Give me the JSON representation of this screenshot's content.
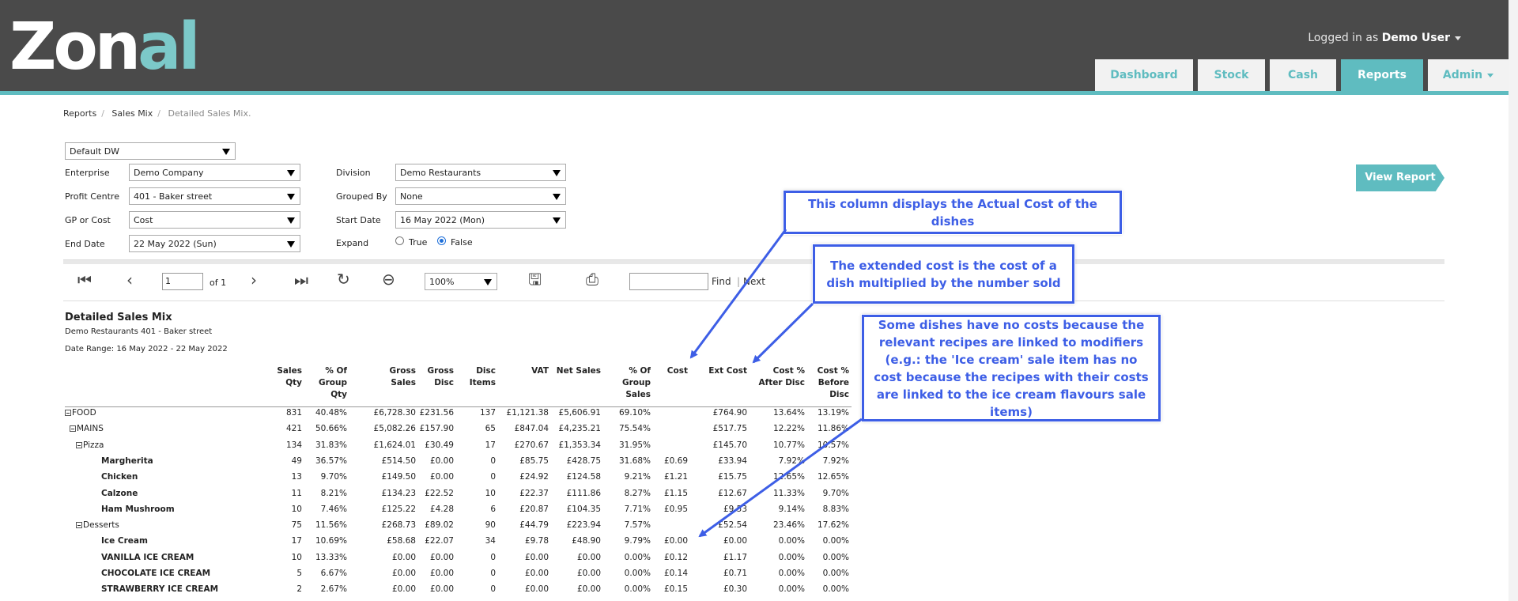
{
  "header": {
    "logo": {
      "part1": "Zon",
      "part2": "al"
    },
    "logged_in_prefix": "Logged in as",
    "user": "Demo User",
    "nav": [
      {
        "label": "Dashboard",
        "active": false
      },
      {
        "label": "Stock",
        "active": false
      },
      {
        "label": "Cash",
        "active": false
      },
      {
        "label": "Reports",
        "active": true
      },
      {
        "label": "Admin",
        "active": false
      }
    ],
    "colors": {
      "bar": "#4a4a4a",
      "accent": "#5fbcc0"
    }
  },
  "breadcrumb": [
    "Reports",
    "Sales Mix",
    "Detailed Sales Mix."
  ],
  "params": {
    "datasource": "Default DW",
    "enterprise_label": "Enterprise",
    "enterprise": "Demo Company",
    "profit_centre_label": "Profit Centre",
    "profit_centre": "401 - Baker street",
    "gp_label": "GP or Cost",
    "gp": "Cost",
    "end_date_label": "End Date",
    "end_date": "22 May 2022 (Sun)",
    "division_label": "Division",
    "division": "Demo Restaurants",
    "grouped_by_label": "Grouped By",
    "grouped_by": "None",
    "start_date_label": "Start Date",
    "start_date": "16 May 2022 (Mon)",
    "expand_label": "Expand",
    "expand_true": "True",
    "expand_false": "False",
    "view_report": "View Report"
  },
  "toolbar": {
    "page": "1",
    "of": "of 1",
    "zoom": "100%",
    "find": "Find",
    "sep": "|",
    "next": "Next",
    "icons": [
      "first-page-icon",
      "previous-page-icon",
      "next-page-icon",
      "last-page-icon",
      "refresh-icon",
      "back-icon",
      "save-icon",
      "print-icon"
    ]
  },
  "report": {
    "title": "Detailed Sales Mix",
    "subtitle": "Demo Restaurants 401 - Baker street",
    "date_range": "Date Range: 16 May 2022 - 22 May 2022",
    "columns": [
      "Sales\nQty",
      "% Of\nGroup\nQty",
      "Gross\nSales",
      "Gross\nDisc",
      "Disc\nItems",
      "VAT",
      "Net Sales",
      "% Of\nGroup\nSales",
      "Cost",
      "Ext Cost",
      "Cost %\nAfter Disc",
      "Cost %\nBefore\nDisc"
    ],
    "rows": [
      {
        "name": "FOOD",
        "level": 0,
        "tree": true,
        "bold": false,
        "vals": [
          "831",
          "40.48%",
          "£6,728.30",
          "£231.56",
          "137",
          "£1,121.38",
          "£5,606.91",
          "69.10%",
          "",
          "£764.90",
          "13.64%",
          "13.19%"
        ]
      },
      {
        "name": "MAINS",
        "level": 1,
        "tree": true,
        "bold": false,
        "vals": [
          "421",
          "50.66%",
          "£5,082.26",
          "£157.90",
          "65",
          "£847.04",
          "£4,235.21",
          "75.54%",
          "",
          "£517.75",
          "12.22%",
          "11.86%"
        ]
      },
      {
        "name": "Pizza",
        "level": 2,
        "tree": true,
        "bold": false,
        "vals": [
          "134",
          "31.83%",
          "£1,624.01",
          "£30.49",
          "17",
          "£270.67",
          "£1,353.34",
          "31.95%",
          "",
          "£145.70",
          "10.77%",
          "10.57%"
        ]
      },
      {
        "name": "Margherita",
        "level": 3,
        "tree": false,
        "bold": true,
        "vals": [
          "49",
          "36.57%",
          "£514.50",
          "£0.00",
          "0",
          "£85.75",
          "£428.75",
          "31.68%",
          "£0.69",
          "£33.94",
          "7.92%",
          "7.92%"
        ]
      },
      {
        "name": "Chicken",
        "level": 3,
        "tree": false,
        "bold": true,
        "vals": [
          "13",
          "9.70%",
          "£149.50",
          "£0.00",
          "0",
          "£24.92",
          "£124.58",
          "9.21%",
          "£1.21",
          "£15.75",
          "12.65%",
          "12.65%"
        ]
      },
      {
        "name": "Calzone",
        "level": 3,
        "tree": false,
        "bold": true,
        "vals": [
          "11",
          "8.21%",
          "£134.23",
          "£22.52",
          "10",
          "£22.37",
          "£111.86",
          "8.27%",
          "£1.15",
          "£12.67",
          "11.33%",
          "9.70%"
        ]
      },
      {
        "name": "Ham Mushroom",
        "level": 3,
        "tree": false,
        "bold": true,
        "vals": [
          "10",
          "7.46%",
          "£125.22",
          "£4.28",
          "6",
          "£20.87",
          "£104.35",
          "7.71%",
          "£0.95",
          "£9.53",
          "9.14%",
          "8.83%"
        ]
      },
      {
        "name": "Desserts",
        "level": 2,
        "tree": true,
        "bold": false,
        "vals": [
          "75",
          "11.56%",
          "£268.73",
          "£89.02",
          "90",
          "£44.79",
          "£223.94",
          "7.57%",
          "",
          "£52.54",
          "23.46%",
          "17.62%"
        ]
      },
      {
        "name": "Ice Cream",
        "level": 3,
        "tree": false,
        "bold": true,
        "vals": [
          "17",
          "10.69%",
          "£58.68",
          "£22.07",
          "34",
          "£9.78",
          "£48.90",
          "9.79%",
          "£0.00",
          "£0.00",
          "0.00%",
          "0.00%"
        ]
      },
      {
        "name": "VANILLA ICE CREAM",
        "level": 3,
        "tree": false,
        "bold": true,
        "vals": [
          "10",
          "13.33%",
          "£0.00",
          "£0.00",
          "0",
          "£0.00",
          "£0.00",
          "0.00%",
          "£0.12",
          "£1.17",
          "0.00%",
          "0.00%"
        ]
      },
      {
        "name": "CHOCOLATE ICE CREAM",
        "level": 3,
        "tree": false,
        "bold": true,
        "vals": [
          "5",
          "6.67%",
          "£0.00",
          "£0.00",
          "0",
          "£0.00",
          "£0.00",
          "0.00%",
          "£0.14",
          "£0.71",
          "0.00%",
          "0.00%"
        ]
      },
      {
        "name": "STRAWBERRY ICE CREAM",
        "level": 3,
        "tree": false,
        "bold": true,
        "vals": [
          "2",
          "2.67%",
          "£0.00",
          "£0.00",
          "0",
          "£0.00",
          "£0.00",
          "0.00%",
          "£0.15",
          "£0.30",
          "0.00%",
          "0.00%"
        ]
      }
    ]
  },
  "callouts": {
    "cost": "This column displays the Actual Cost of the dishes",
    "ext_cost": "The extended cost is the cost of a dish multiplied by the number sold",
    "no_cost": "Some dishes have no costs because the relevant recipes are linked to modifiers (e.g.: the 'Ice cream' sale item has no cost because the recipes with their costs are linked to the ice cream flavours sale items)",
    "color": "#3d5ee6"
  }
}
